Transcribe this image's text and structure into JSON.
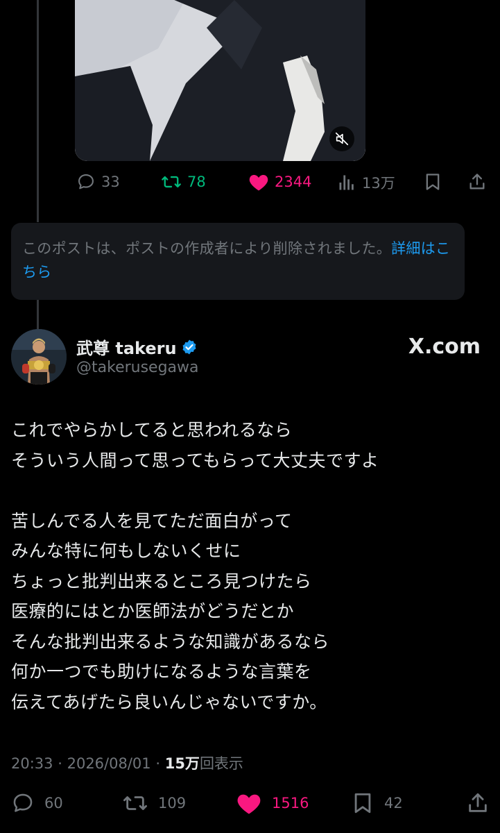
{
  "colors": {
    "background": "#000000",
    "text": "#e7e9ea",
    "muted": "#71767b",
    "accent": "#1d9bf0",
    "like": "#f91880",
    "repost": "#00ba7c"
  },
  "parent_post": {
    "media_control_icon": "muted-speaker-icon",
    "actions": {
      "replies": "33",
      "reposts": "78",
      "likes": "2344",
      "views": "13万"
    }
  },
  "deleted_notice": {
    "text": "このポストは、ポストの作成者により削除されました。",
    "link": "詳細はこちら"
  },
  "post": {
    "display_name": "武尊 takeru",
    "handle": "@takerusegawa",
    "source": "X.com",
    "verified": true,
    "text": "これでやらかしてると思われるなら\nそういう人間って思ってもらって大丈夫ですよ\n\n苦しんでる人を見てただ面白がって\nみんな特に何もしないくせに\nちょっと批判出来るところ見つけたら\n医療的にはとか医師法がどうだとか\nそんな批判出来るような知識があるなら\n何か一つでも助けになるような言葉を\n伝えてあげたら良いんじゃないですか。",
    "time": "20:33",
    "date": "2026/08/01",
    "separator": "·",
    "views_count": "15万",
    "views_label": "回表示",
    "actions": {
      "replies": "60",
      "reposts": "109",
      "likes": "1516",
      "bookmarks": "42"
    }
  }
}
